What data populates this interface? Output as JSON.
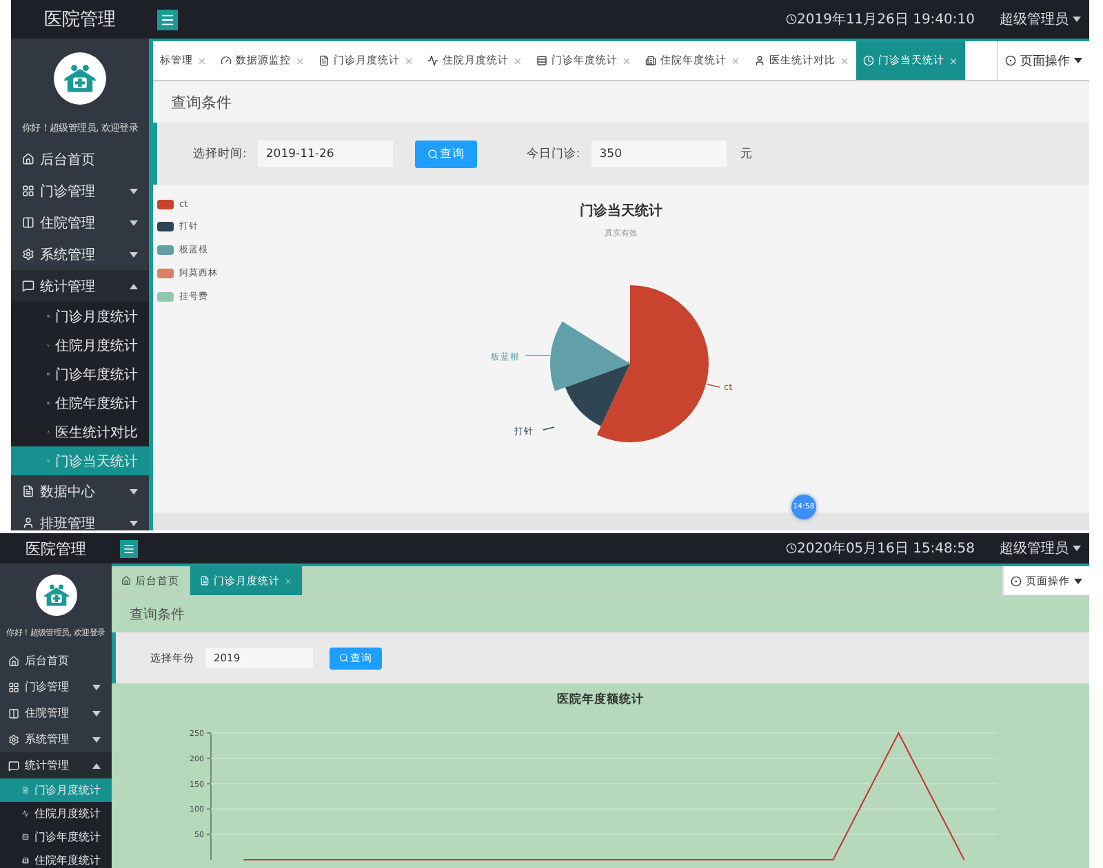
{
  "screens": [
    {
      "header": {
        "brand": "医院管理",
        "datetime": "2019年11月26日 19:40:10",
        "user": "超级管理员"
      },
      "sidebar": {
        "greeting": "你好！超级管理员, 欢迎登录",
        "items": [
          {
            "kind": "link",
            "label": "后台首页",
            "selected": false
          },
          {
            "kind": "group",
            "label": "门诊管理",
            "expanded": false
          },
          {
            "kind": "group",
            "label": "住院管理",
            "expanded": false
          },
          {
            "kind": "group",
            "label": "系统管理",
            "expanded": false
          },
          {
            "kind": "group",
            "label": "统计管理",
            "expanded": true,
            "children": [
              {
                "label": "门诊月度统计",
                "selected": false
              },
              {
                "label": "住院月度统计",
                "selected": false
              },
              {
                "label": "门诊年度统计",
                "selected": false
              },
              {
                "label": "住院年度统计",
                "selected": false
              },
              {
                "label": "医生统计对比",
                "selected": false
              },
              {
                "label": "门诊当天统计",
                "selected": true
              }
            ]
          },
          {
            "kind": "group",
            "label": "数据中心",
            "expanded": false
          },
          {
            "kind": "group",
            "label": "排班管理",
            "expanded": false
          }
        ]
      },
      "tabs": [
        {
          "label": "标管理",
          "selected": false,
          "closable": true
        },
        {
          "label": "数据源监控",
          "selected": false,
          "closable": true
        },
        {
          "label": "门诊月度统计",
          "selected": false,
          "closable": true
        },
        {
          "label": "住院月度统计",
          "selected": false,
          "closable": true
        },
        {
          "label": "门诊年度统计",
          "selected": false,
          "closable": true
        },
        {
          "label": "住院年度统计",
          "selected": false,
          "closable": true
        },
        {
          "label": "医生统计对比",
          "selected": false,
          "closable": true
        },
        {
          "label": "门诊当天统计",
          "selected": true,
          "closable": true
        }
      ],
      "page_actions": "页面操作",
      "query": {
        "title": "查询条件",
        "field": {
          "label": "选择时间:",
          "value": "2019-11-26"
        },
        "button": "查询",
        "extra": {
          "label": "今日门诊:",
          "value": "350",
          "unit": "元"
        }
      },
      "content": {
        "kind": "pie",
        "title": "门诊当天统计",
        "subtitle": "真实有效",
        "legend": [
          {
            "label": "ct",
            "color": "#c9432f"
          },
          {
            "label": "打针",
            "color": "#2f4554"
          },
          {
            "label": "板蓝根",
            "color": "#61a0a8"
          },
          {
            "label": "阿莫西林",
            "color": "#d48265"
          },
          {
            "label": "挂号费",
            "color": "#91c7ae"
          }
        ],
        "slice_labels": [
          "ct",
          "打针",
          "板蓝根"
        ],
        "badge": "14:58"
      }
    },
    {
      "header": {
        "brand": "医院管理",
        "datetime": "2020年05月16日 15:48:58",
        "user": "超级管理员"
      },
      "sidebar": {
        "greeting": "你好！超级管理员, 欢迎登录",
        "items": [
          {
            "kind": "link",
            "label": "后台首页",
            "selected": false
          },
          {
            "kind": "group",
            "label": "门诊管理",
            "expanded": false
          },
          {
            "kind": "group",
            "label": "住院管理",
            "expanded": false
          },
          {
            "kind": "group",
            "label": "系统管理",
            "expanded": false
          },
          {
            "kind": "group",
            "label": "统计管理",
            "expanded": true,
            "children": [
              {
                "label": "门诊月度统计",
                "selected": true
              },
              {
                "label": "住院月度统计",
                "selected": false
              },
              {
                "label": "门诊年度统计",
                "selected": false
              },
              {
                "label": "住院年度统计",
                "selected": false
              }
            ]
          }
        ]
      },
      "tabs": [
        {
          "label": "后台首页",
          "selected": false,
          "closable": false
        },
        {
          "label": "门诊月度统计",
          "selected": true,
          "closable": true
        }
      ],
      "page_actions": "页面操作",
      "query": {
        "title": "查询条件",
        "field": {
          "label": "选择年份",
          "value": "2019"
        },
        "button": "查询"
      },
      "content": {
        "kind": "line",
        "chart_data": {
          "type": "line",
          "title": "医院年度额统计",
          "ylim": [
            0,
            250
          ],
          "yticks": [
            50,
            100,
            150,
            200,
            250
          ],
          "grid": true,
          "series": [
            {
              "color": "#c23531",
              "values": [
                0,
                0,
                0,
                0,
                0,
                0,
                0,
                0,
                0,
                0,
                250,
                0
              ]
            }
          ]
        }
      }
    }
  ]
}
